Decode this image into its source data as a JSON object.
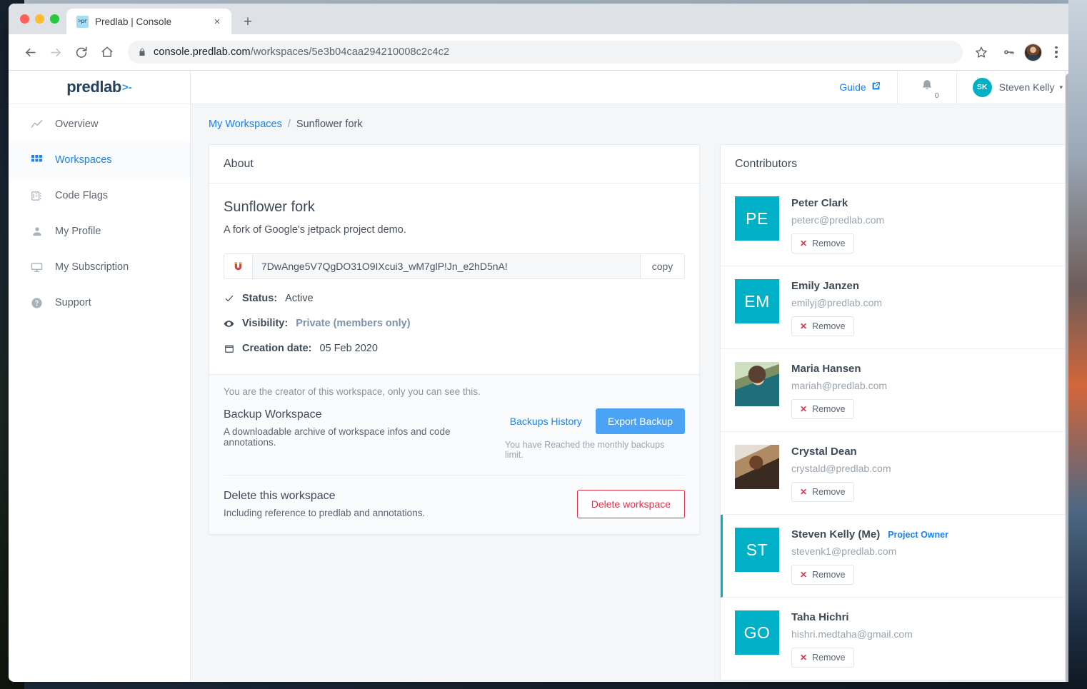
{
  "browser": {
    "tab": {
      "title": "Predlab | Console",
      "favicon_text": ">pr",
      "close_glyph": "×"
    },
    "new_tab_glyph": "+",
    "address": {
      "secure_host": "console.predlab.com",
      "path": "/workspaces/5e3b04caa294210008c2c4c2"
    }
  },
  "sidebar": {
    "brand": {
      "name": "predlab",
      "mark": ">-"
    },
    "items": [
      {
        "label": "Overview",
        "icon": "trend-line-icon",
        "active": false
      },
      {
        "label": "Workspaces",
        "icon": "grid-icon",
        "active": true
      },
      {
        "label": "Code Flags",
        "icon": "code-flag-icon",
        "active": false
      },
      {
        "label": "My Profile",
        "icon": "person-icon",
        "active": false
      },
      {
        "label": "My Subscription",
        "icon": "monitor-icon",
        "active": false
      },
      {
        "label": "Support",
        "icon": "help-circle-icon",
        "active": false
      }
    ]
  },
  "topbar": {
    "guide_label": "Guide",
    "guide_icon": "external-link-icon",
    "bell_icon": "bell-icon",
    "notification_count": "0",
    "user": {
      "initials": "SK",
      "name": "Steven Kelly",
      "caret": "▾"
    }
  },
  "breadcrumb": {
    "root": "My Workspaces",
    "separator": "/",
    "current": "Sunflower fork"
  },
  "about": {
    "card_title": "About",
    "workspace_name": "Sunflower fork",
    "workspace_description": "A fork of Google's jetpack project demo.",
    "token": {
      "icon": "magnet-icon",
      "value": "7DwAnge5V7QgDO31O9IXcui3_wM7glP!Jn_e2hD5nA!",
      "copy_label": "copy"
    },
    "meta": [
      {
        "icon": "check-icon",
        "label": "Status:",
        "value": "Active",
        "link": false
      },
      {
        "icon": "eye-icon",
        "label": "Visibility:",
        "value": "Private (members only)",
        "link": true
      },
      {
        "icon": "calendar-icon",
        "label": "Creation date:",
        "value": "05 Feb 2020",
        "link": false
      }
    ],
    "creator_note": "You are the creator of this workspace, only you can see this.",
    "backup": {
      "title": "Backup Workspace",
      "subtitle": "A downloadable archive of workspace infos and code annotations.",
      "history_link": "Backups History",
      "export_button": "Export Backup",
      "limit_note": "You have Reached the monthly backups limit."
    },
    "delete": {
      "title": "Delete this workspace",
      "subtitle": "Including reference to predlab and annotations.",
      "button": "Delete workspace"
    }
  },
  "contributors": {
    "card_title": "Contributors",
    "remove_label": "Remove",
    "remove_icon": "x-icon",
    "owner_badge": "Project Owner",
    "people": [
      {
        "name": "Peter Clark",
        "email": "peterc@predlab.com",
        "initials": "PE",
        "avatar_type": "initials",
        "is_me": false,
        "owner": false
      },
      {
        "name": "Emily Janzen",
        "email": "emilyj@predlab.com",
        "initials": "EM",
        "avatar_type": "initials",
        "is_me": false,
        "owner": false
      },
      {
        "name": "Maria Hansen",
        "email": "mariah@predlab.com",
        "initials": "",
        "avatar_type": "photo1",
        "is_me": false,
        "owner": false
      },
      {
        "name": "Crystal Dean",
        "email": "crystald@predlab.com",
        "initials": "",
        "avatar_type": "photo2",
        "is_me": false,
        "owner": false
      },
      {
        "name": "Steven Kelly (Me)",
        "email": "stevenk1@predlab.com",
        "initials": "ST",
        "avatar_type": "initials",
        "is_me": true,
        "owner": true
      },
      {
        "name": "Taha Hichri",
        "email": "hishri.medtaha@gmail.com",
        "initials": "GO",
        "avatar_type": "initials",
        "is_me": false,
        "owner": false
      }
    ]
  },
  "colors": {
    "accent_blue": "#1a82f7",
    "primary_button": "#4ba3f5",
    "teal": "#00b0c7",
    "danger": "#e0334b",
    "text_dark": "#3f4a58",
    "text_muted": "#9aa3ae"
  }
}
